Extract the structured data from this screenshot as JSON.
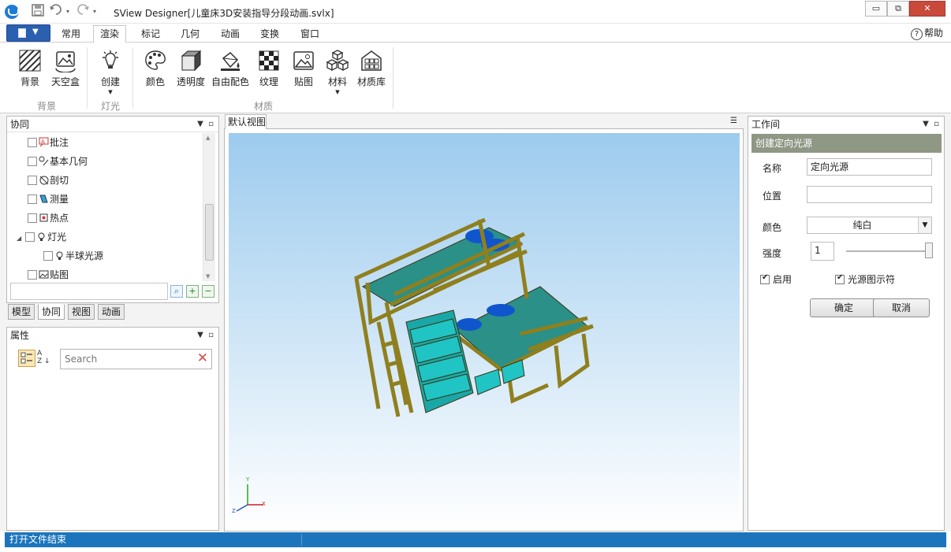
{
  "window": {
    "title": "SView Designer[儿童床3D安装指导分段动画.svlx]",
    "controls": [
      "▭",
      "⧉",
      "✕"
    ]
  },
  "quick_access": [
    "save-icon",
    "undo-icon",
    "redo-icon"
  ],
  "ribbon": {
    "tabs": [
      "常用",
      "渲染",
      "标记",
      "几何",
      "动画",
      "变换",
      "窗口"
    ],
    "active_tab": "渲染",
    "help_label": "帮助",
    "buttons": {
      "background": "背景",
      "skybox": "天空盒",
      "create": "创建",
      "color": "颜色",
      "transparency": "透明度",
      "free_color": "自由配色",
      "texture": "纹理",
      "decal": "贴图",
      "material": "材料",
      "material_library": "材质库"
    },
    "groups": {
      "background": "背景",
      "light": "灯光",
      "material": "材质"
    }
  },
  "collab_panel": {
    "title": "协同",
    "items": [
      "批注",
      "基本几何",
      "剖切",
      "测量",
      "热点",
      "灯光",
      "半球光源",
      "贴图"
    ],
    "bottom_tabs": [
      "模型",
      "协同",
      "视图",
      "动画"
    ],
    "active_bottom_tab": "协同"
  },
  "properties_panel": {
    "title": "属性",
    "search_placeholder": "Search"
  },
  "viewport": {
    "tab_label": "默认视图",
    "axis_labels": {
      "x": "X",
      "y": "Y",
      "z": "Z"
    }
  },
  "workspace_panel": {
    "title": "工作间",
    "section_title": "创建定向光源",
    "name_label": "名称",
    "name_value": "定向光源",
    "position_label": "位置",
    "position_value": "",
    "color_label": "颜色",
    "color_value": "纯白",
    "intensity_label": "强度",
    "intensity_value": "1",
    "intensity_slider": 1.0,
    "enable_label": "启用",
    "enable_checked": true,
    "indicator_label": "光源图示符",
    "indicator_checked": true,
    "ok_label": "确定",
    "cancel_label": "取消"
  },
  "status": {
    "message": "打开文件结束"
  },
  "colors": {
    "status_blue": "#1c75bc",
    "section_header": "#8f9785",
    "bed_frame": "#8f7f1e",
    "bed_teal": "#1f8f8a",
    "pillow": "#1155cc"
  }
}
